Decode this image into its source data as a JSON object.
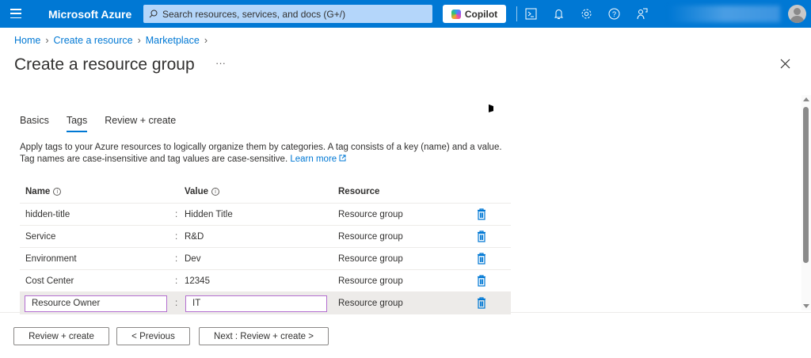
{
  "topbar": {
    "brand": "Microsoft Azure",
    "search_placeholder": "Search resources, services, and docs (G+/)",
    "copilot_label": "Copilot"
  },
  "breadcrumb": [
    {
      "label": "Home"
    },
    {
      "label": "Create a resource"
    },
    {
      "label": "Marketplace"
    }
  ],
  "page": {
    "title": "Create a resource group",
    "more": "···"
  },
  "tabs": [
    {
      "label": "Basics"
    },
    {
      "label": "Tags",
      "active": true
    },
    {
      "label": "Review + create"
    }
  ],
  "description": {
    "text": "Apply tags to your Azure resources to logically organize them by categories. A tag consists of a key (name) and a value. Tag names are case-insensitive and tag values are case-sensitive. ",
    "link": "Learn more"
  },
  "table": {
    "headers": {
      "name": "Name",
      "value": "Value",
      "resource": "Resource"
    },
    "separator": ":",
    "rows": [
      {
        "name": "hidden-title",
        "value": "Hidden Title",
        "resource": "Resource group"
      },
      {
        "name": "Service",
        "value": "R&D",
        "resource": "Resource group"
      },
      {
        "name": "Environment",
        "value": "Dev",
        "resource": "Resource group"
      },
      {
        "name": "Cost Center",
        "value": "12345",
        "resource": "Resource group"
      },
      {
        "name": "Resource Owner",
        "value": "IT",
        "resource": "Resource group"
      }
    ]
  },
  "footer": {
    "review_create": "Review + create",
    "previous": "< Previous",
    "next": "Next : Review + create >"
  },
  "colors": {
    "brand": "#0078d4",
    "input_border": "#b46ed0"
  }
}
